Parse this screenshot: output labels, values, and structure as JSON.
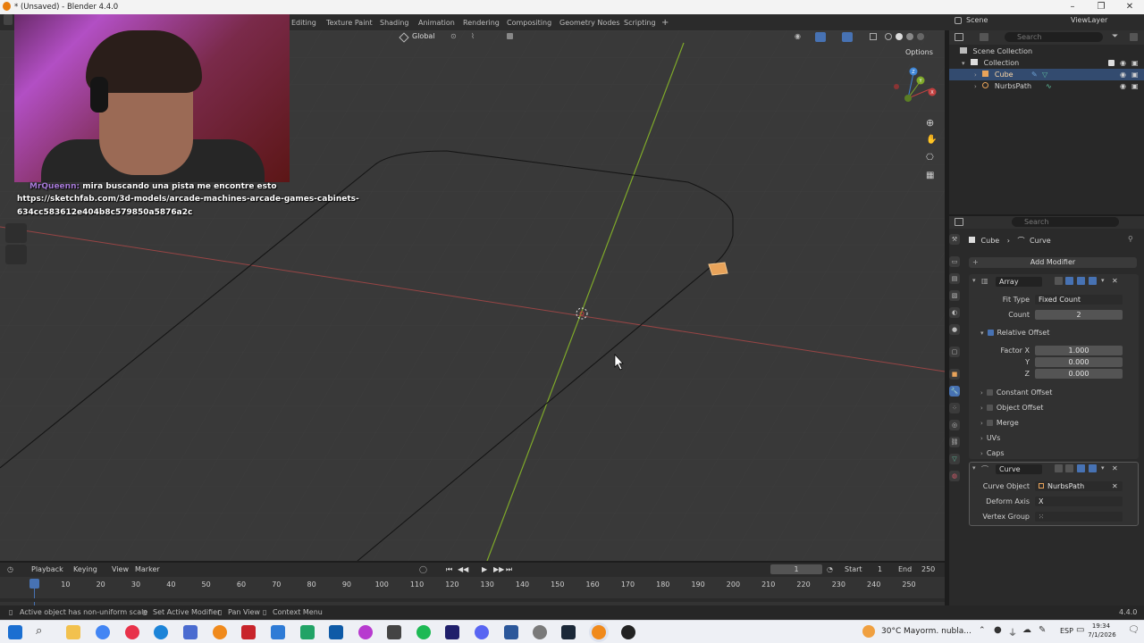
{
  "window": {
    "title": "* (Unsaved) - Blender 4.4.0",
    "minimize": "–",
    "maximize": "❐",
    "close": "✕"
  },
  "workspaces": [
    "Editing",
    "Texture Paint",
    "Shading",
    "Animation",
    "Rendering",
    "Compositing",
    "Geometry Nodes",
    "Scripting"
  ],
  "add_workspace": "+",
  "viewport": {
    "transform_orientation": "Global",
    "options_label": "Options"
  },
  "gizmo_axes": {
    "x": "X",
    "y": "Y",
    "z": "Z"
  },
  "chat": {
    "user": "MrQueenn:",
    "message": "mira buscando una pista me encontre esto",
    "link_line1": "https://sketchfab.com/3d-models/arcade-machines-arcade-games-cabinets-",
    "link_line2": "634cc583612e404b8c579850a5876a2c"
  },
  "scene": {
    "name": "Scene",
    "view_layer": "ViewLayer",
    "search_placeholder": "Search"
  },
  "outliner": {
    "root": "Scene Collection",
    "collection": "Collection",
    "items": [
      {
        "name": "Cube",
        "selected": true
      },
      {
        "name": "NurbsPath",
        "selected": false
      }
    ]
  },
  "properties": {
    "search_placeholder": "Search",
    "breadcrumb_object": "Cube",
    "breadcrumb_sep": "›",
    "breadcrumb_data": "Curve",
    "add_modifier": "Add Modifier",
    "array": {
      "name": "Array",
      "fit_type_label": "Fit Type",
      "fit_type_value": "Fixed Count",
      "count_label": "Count",
      "count_value": "2",
      "relative_offset_label": "Relative Offset",
      "factor_x_label": "Factor X",
      "factor_x": "1.000",
      "y_label": "Y",
      "factor_y": "0.000",
      "z_label": "Z",
      "factor_z": "0.000",
      "subpanels": [
        "Constant Offset",
        "Object Offset",
        "Merge",
        "UVs",
        "Caps"
      ]
    },
    "curve": {
      "name": "Curve",
      "curve_object_label": "Curve Object",
      "curve_object_value": "NurbsPath",
      "deform_axis_label": "Deform Axis",
      "deform_axis_value": "X",
      "vertex_group_label": "Vertex Group"
    }
  },
  "timeline": {
    "menus": [
      "Playback",
      "Keying",
      "View",
      "Marker"
    ],
    "current_frame": "1",
    "start_label": "Start",
    "start": "1",
    "end_label": "End",
    "end": "250",
    "ticks": [
      "1",
      "10",
      "20",
      "30",
      "40",
      "50",
      "60",
      "70",
      "80",
      "90",
      "100",
      "110",
      "120",
      "130",
      "140",
      "150",
      "160",
      "170",
      "180",
      "190",
      "200",
      "210",
      "220",
      "230",
      "240",
      "250"
    ]
  },
  "status": {
    "warning": "Active object has non-uniform scale",
    "hint1": "Set Active Modifier",
    "hint2": "Pan View",
    "hint3": "Context Menu",
    "version": "4.4.0"
  },
  "taskbar": {
    "weather": "30°C",
    "weather_desc": "Mayorm. nubla...",
    "lang": "ESP",
    "time": "19:34",
    "date": "7/1/2026"
  },
  "colors": {
    "accent": "#4772b3",
    "x_axis": "#c0392b",
    "y_axis": "#8fc02a",
    "selected_object": "#e8a35a"
  }
}
